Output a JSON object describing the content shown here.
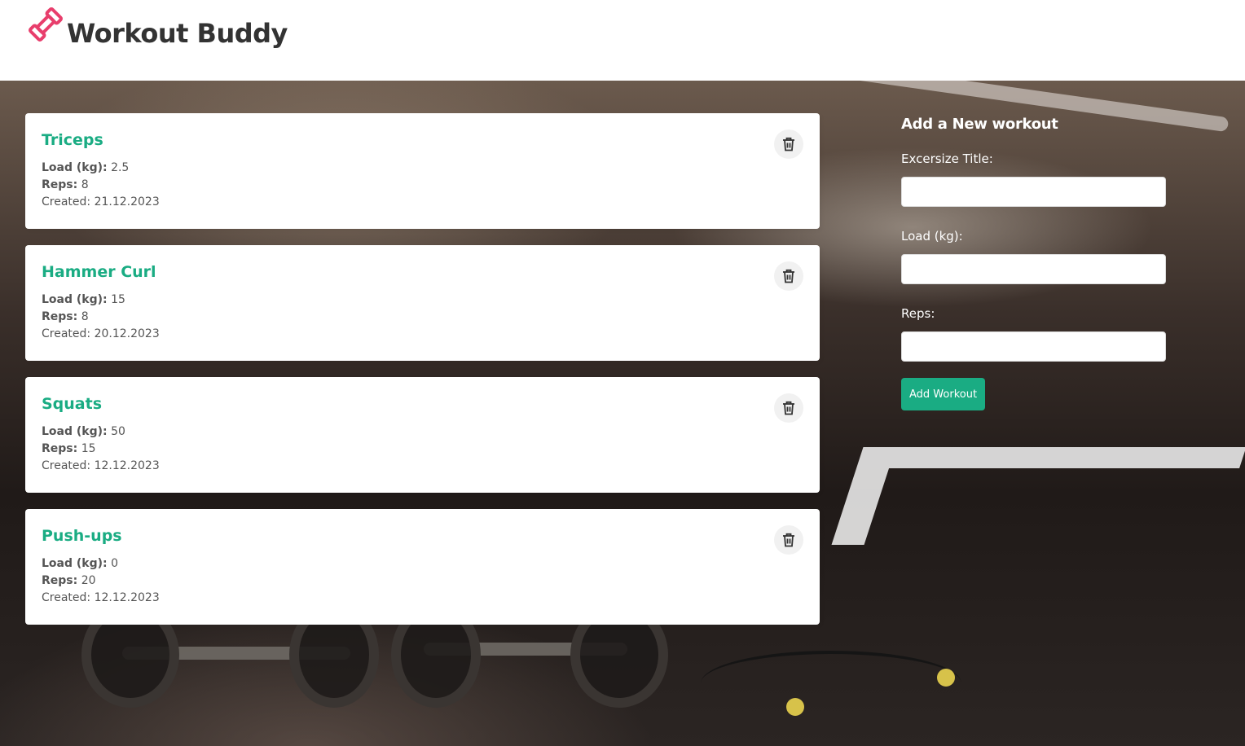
{
  "header": {
    "title": "Workout Buddy",
    "logo_icon": "dumbbell-logo-icon",
    "logo_color": "#e83e6c"
  },
  "workouts": [
    {
      "title": "Triceps",
      "load_label": "Load (kg):",
      "load": "2.5",
      "reps_label": "Reps:",
      "reps": "8",
      "created": "Created: 21.12.2023",
      "delete_icon": "trash-icon"
    },
    {
      "title": "Hammer Curl",
      "load_label": "Load (kg):",
      "load": "15",
      "reps_label": "Reps:",
      "reps": "8",
      "created": "Created: 20.12.2023",
      "delete_icon": "trash-icon"
    },
    {
      "title": "Squats",
      "load_label": "Load (kg):",
      "load": "50",
      "reps_label": "Reps:",
      "reps": "15",
      "created": "Created: 12.12.2023",
      "delete_icon": "trash-icon"
    },
    {
      "title": "Push-ups",
      "load_label": "Load (kg):",
      "load": "0",
      "reps_label": "Reps:",
      "reps": "20",
      "created": "Created: 12.12.2023",
      "delete_icon": "trash-icon"
    }
  ],
  "form": {
    "heading": "Add a New workout",
    "title_label": "Excersize Title:",
    "title_value": "",
    "load_label": "Load (kg):",
    "load_value": "",
    "reps_label": "Reps:",
    "reps_value": "",
    "submit_label": "Add Workout"
  },
  "colors": {
    "accent": "#1aac83",
    "brand_icon": "#e83e6c"
  }
}
